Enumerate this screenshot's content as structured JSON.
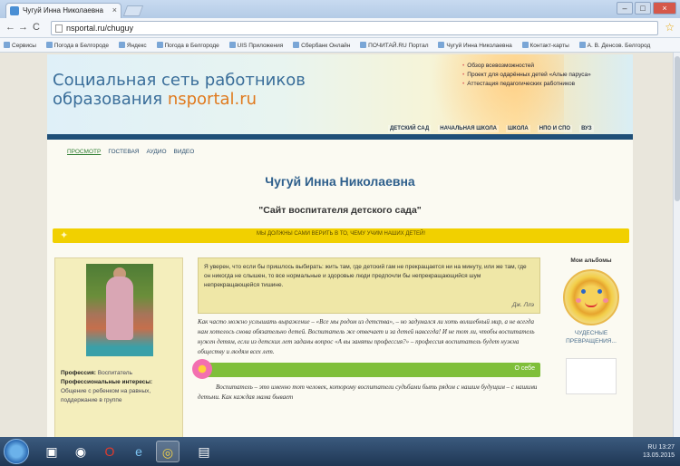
{
  "browser": {
    "tab_title": "Чугуй Инна Николаевна",
    "tab_close": "×",
    "url": "nsportal.ru/chuguy",
    "window_buttons": [
      "–",
      "□",
      "×"
    ],
    "bookmarks": [
      "Сервисы",
      "Погода в Белгороде",
      "Яндекс",
      "Погода в Белгороде",
      "UIS Приложения",
      "Сбербанк Онлайн",
      "ПОЧИТАЙ.RU Портал",
      "Чугуй Инна Николаевна",
      "Контакт-карты",
      "А. В. Денсов. Белгород"
    ]
  },
  "header": {
    "title_line1": "Социальная сеть работников",
    "title_line2_prefix": "образования ",
    "title_domain": "nsportal.ru",
    "links": [
      "Обзор всевозможностей",
      "Проект для одарённых детей «Алые паруса»",
      "Аттестация педагогических работников"
    ],
    "nav": [
      "ДЕТСКИЙ САД",
      "НАЧАЛЬНАЯ ШКОЛА",
      "ШКОЛА",
      "НПО И СПО",
      "ВУЗ"
    ]
  },
  "page": {
    "tabs": [
      "ПРОСМОТР",
      "ГОСТЕВАЯ",
      "АУДИО",
      "ВИДЕО"
    ],
    "name": "Чугуй Инна Николаевна",
    "subtitle": "\"Сайт воспитателя детского сада\"",
    "motto": "МЫ ДОЛЖНЫ САМИ ВЕРИТЬ В ТО, ЧЕМУ УЧИМ НАШИХ ДЕТЕЙ!",
    "quote": "Я уверен, что если бы пришлось выбирать: жить там, где детский гам не прекращается ни на минуту, или же там, где он никогда не слышен, то все нормальные и здоровые люди предпочли бы непрекращающийся шум непрекращающейся тишине.",
    "quote_author": "Дж. Ллэ",
    "intro": "Как часто можно услышать выражение – «Все мы родом из детства», – но задумался ли хоть волшебный мир, а не всегда нам хотелось снова обязательно детей. Воспитатель же отвечает и за детей навсегда! И не тот ли, чтобы воспитатель нужен детям, если из детских лет заданы вопрос «А вы заняты профессия?» – профессия воспитатель будет нужна обществу и людям всех лет.",
    "section_label": "О себе",
    "about": "Воспитатель – это именно тот человек, которому воспитатели судьбами быть рядом с нашим будущим – с нашими детьми. Как каждая мама бывает",
    "profile_label": "Профессия:",
    "profile_value": "Воспитатель",
    "interests_label": "Профессиональные интересы:",
    "interests_value": "Общение с ребенком на равных, поддержание в группе",
    "albums_title": "Мои альбомы",
    "album_caption": "ЧУДЕСНЫЕ ПРЕВРАЩЕНИЯ..."
  },
  "taskbar": {
    "time": "13:27",
    "date": "13.05.2015",
    "lang": "RU"
  }
}
